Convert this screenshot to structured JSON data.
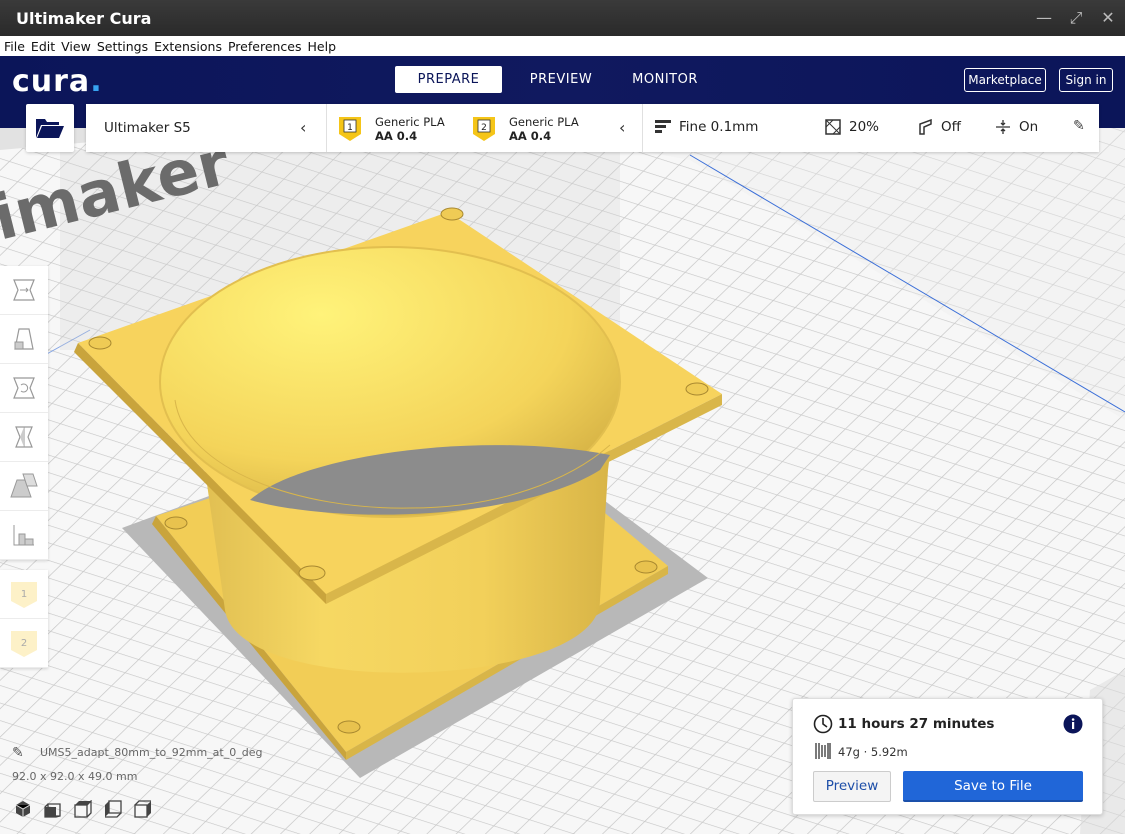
{
  "window": {
    "title": "Ultimaker Cura"
  },
  "menu": [
    "File",
    "Edit",
    "View",
    "Settings",
    "Extensions",
    "Preferences",
    "Help"
  ],
  "header": {
    "logo": "cura",
    "tabs": [
      "PREPARE",
      "PREVIEW",
      "MONITOR"
    ],
    "marketplace": "Marketplace",
    "signin": "Sign in"
  },
  "printer": {
    "name": "Ultimaker S5",
    "extruders": [
      {
        "index": "1",
        "material": "Generic PLA",
        "nozzle": "AA 0.4"
      },
      {
        "index": "2",
        "material": "Generic PLA",
        "nozzle": "AA 0.4"
      }
    ],
    "profile": "Fine 0.1mm",
    "infill": "20%",
    "support": "Off",
    "adhesion": "On"
  },
  "build_plate_text": "imaker",
  "extruder_tools": [
    "1",
    "2"
  ],
  "object": {
    "name": "UMS5_adapt_80mm_to_92mm_at_0_deg",
    "dimensions": "92.0 x 92.0 x 49.0 mm"
  },
  "print_info": {
    "time": "11 hours 27 minutes",
    "material": "47g · 5.92m",
    "preview_button": "Preview",
    "save_button": "Save to File"
  },
  "colors": {
    "header": "#0b1559",
    "accent": "#2066d8",
    "model": "#f8d35a",
    "extruder_badge": "#f5c518"
  }
}
